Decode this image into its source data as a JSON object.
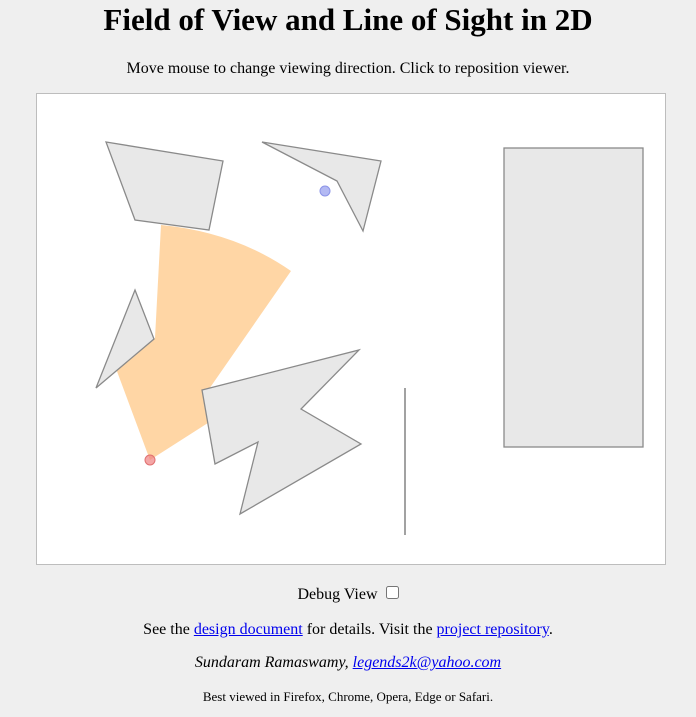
{
  "page": {
    "title": "Field of View and Line of Sight in 2D",
    "instructions": "Move mouse to change viewing direction. Click to reposition viewer."
  },
  "debug": {
    "label": "Debug View",
    "checked": false
  },
  "info": {
    "prefix": "See the ",
    "design_link": "design document",
    "middle": " for details. Visit the ",
    "repo_link": "project repository",
    "suffix": "."
  },
  "author": {
    "name": "Sundaram Ramaswamy",
    "separator": ", ",
    "email": "legends2k@yahoo.com"
  },
  "footer": {
    "browsers": "Best viewed in Firefox, Chrome, Opera, Edge or Safari."
  },
  "colors": {
    "fov_fill": "#ffd6a5",
    "obstacle_fill": "#e8e8e8",
    "obstacle_stroke": "#8a8a8a",
    "viewer": "#f08080",
    "target": "#a0a8f0",
    "link": "#0000ee"
  }
}
